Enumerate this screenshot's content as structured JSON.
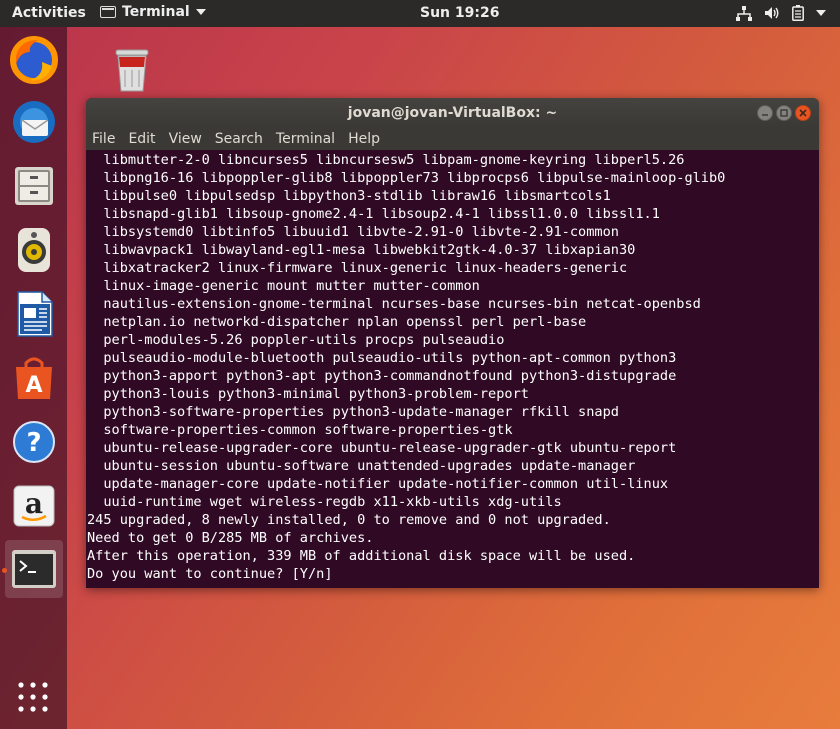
{
  "topbar": {
    "activities": "Activities",
    "app_menu": "Terminal",
    "clock": "Sun 19:26"
  },
  "dock": {
    "items": [
      {
        "name": "firefox-icon"
      },
      {
        "name": "thunderbird-icon"
      },
      {
        "name": "files-icon"
      },
      {
        "name": "rhythmbox-icon"
      },
      {
        "name": "writer-icon"
      },
      {
        "name": "software-center-icon"
      },
      {
        "name": "help-icon"
      },
      {
        "name": "amazon-icon"
      },
      {
        "name": "terminal-icon"
      }
    ]
  },
  "window": {
    "title": "jovan@jovan-VirtualBox: ~",
    "menu": [
      "File",
      "Edit",
      "View",
      "Search",
      "Terminal",
      "Help"
    ]
  },
  "terminal": {
    "lines": [
      "  libmutter-2-0 libncurses5 libncursesw5 libpam-gnome-keyring libperl5.26",
      "  libpng16-16 libpoppler-glib8 libpoppler73 libprocps6 libpulse-mainloop-glib0",
      "  libpulse0 libpulsedsp libpython3-stdlib libraw16 libsmartcols1",
      "  libsnapd-glib1 libsoup-gnome2.4-1 libsoup2.4-1 libssl1.0.0 libssl1.1",
      "  libsystemd0 libtinfo5 libuuid1 libvte-2.91-0 libvte-2.91-common",
      "  libwavpack1 libwayland-egl1-mesa libwebkit2gtk-4.0-37 libxapian30",
      "  libxatracker2 linux-firmware linux-generic linux-headers-generic",
      "  linux-image-generic mount mutter mutter-common",
      "  nautilus-extension-gnome-terminal ncurses-base ncurses-bin netcat-openbsd",
      "  netplan.io networkd-dispatcher nplan openssl perl perl-base",
      "  perl-modules-5.26 poppler-utils procps pulseaudio",
      "  pulseaudio-module-bluetooth pulseaudio-utils python-apt-common python3",
      "  python3-apport python3-apt python3-commandnotfound python3-distupgrade",
      "  python3-louis python3-minimal python3-problem-report",
      "  python3-software-properties python3-update-manager rfkill snapd",
      "  software-properties-common software-properties-gtk",
      "  ubuntu-release-upgrader-core ubuntu-release-upgrader-gtk ubuntu-report",
      "  ubuntu-session ubuntu-software unattended-upgrades update-manager",
      "  update-manager-core update-notifier update-notifier-common util-linux",
      "  uuid-runtime wget wireless-regdb x11-xkb-utils xdg-utils",
      "245 upgraded, 8 newly installed, 0 to remove and 0 not upgraded.",
      "Need to get 0 B/285 MB of archives.",
      "After this operation, 339 MB of additional disk space will be used.",
      "Do you want to continue? [Y/n]"
    ]
  }
}
